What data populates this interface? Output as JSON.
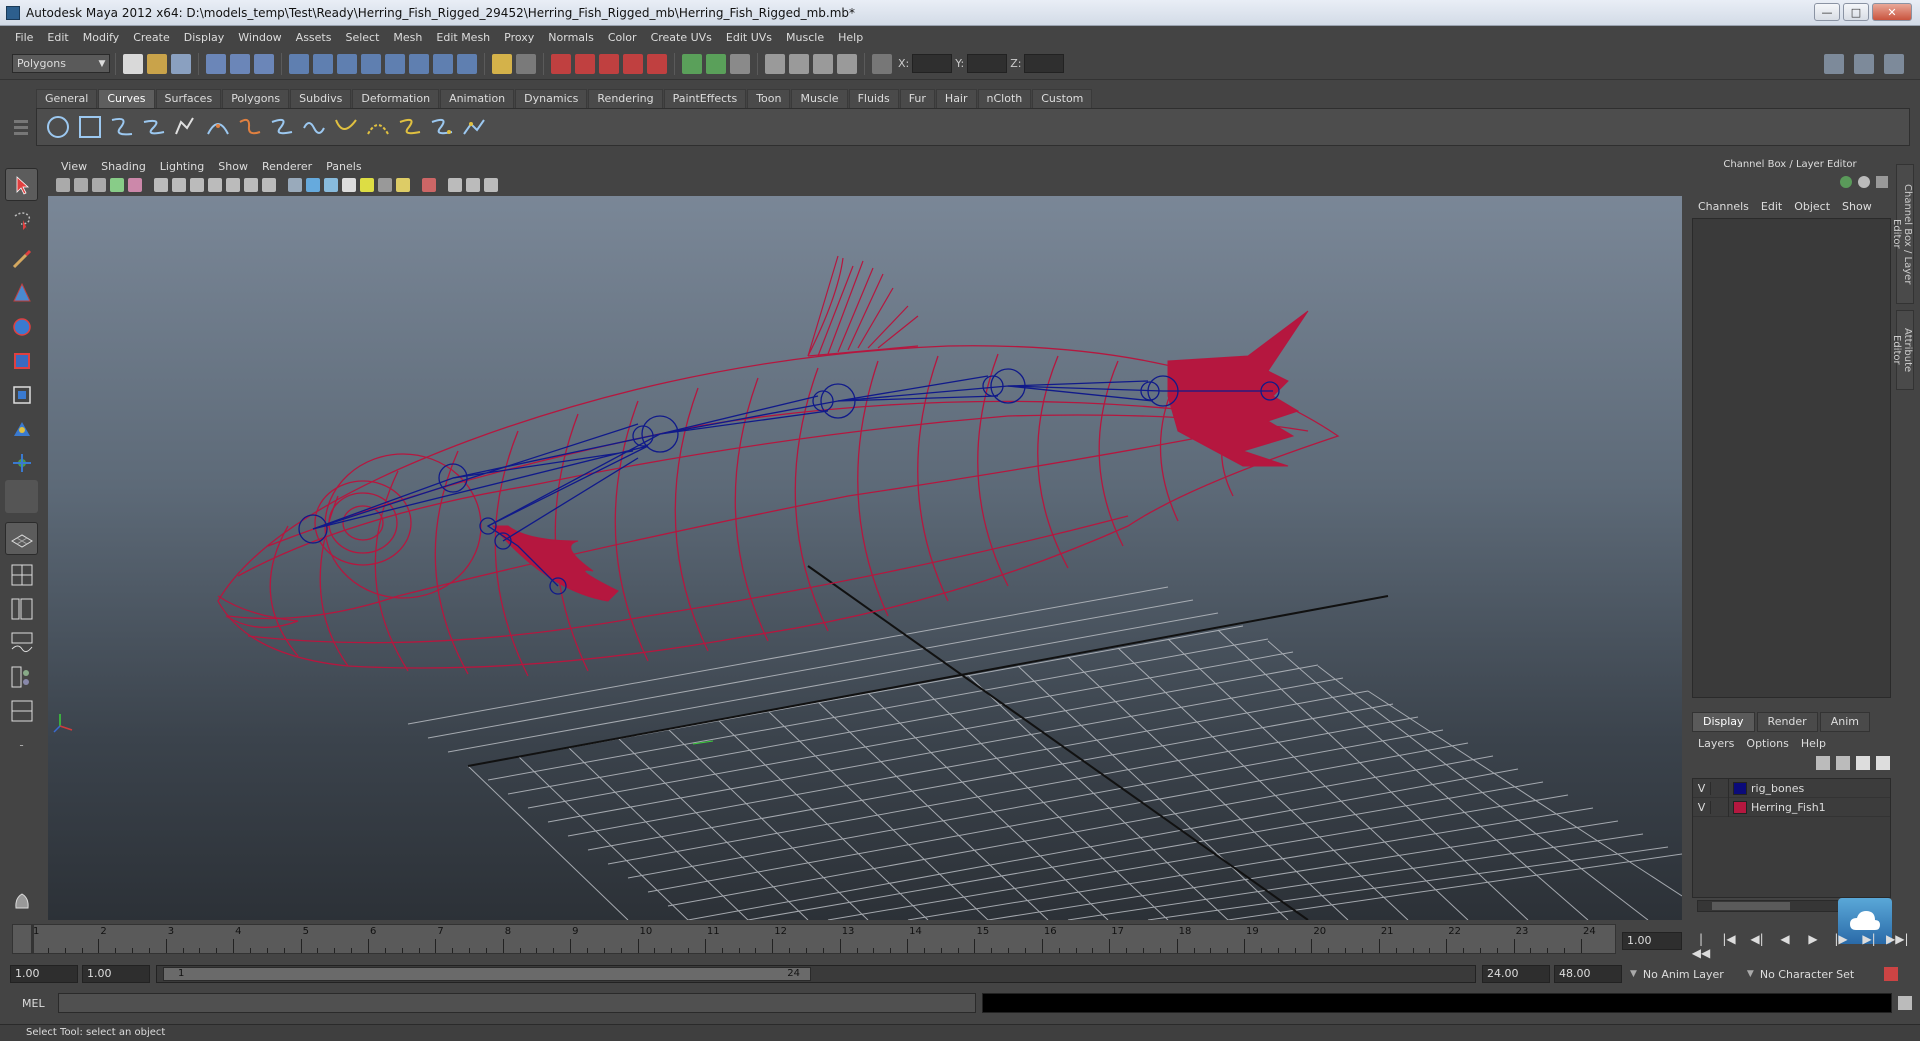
{
  "window": {
    "title": "Autodesk Maya 2012 x64: D:\\models_temp\\Test\\Ready\\Herring_Fish_Rigged_29452\\Herring_Fish_Rigged_mb\\Herring_Fish_Rigged_mb.mb*",
    "minimize": "—",
    "maximize": "□",
    "close": "✕"
  },
  "menubar": [
    "File",
    "Edit",
    "Modify",
    "Create",
    "Display",
    "Window",
    "Assets",
    "Select",
    "Mesh",
    "Edit Mesh",
    "Proxy",
    "Normals",
    "Color",
    "Create UVs",
    "Edit UVs",
    "Muscle",
    "Help"
  ],
  "statusline": {
    "mode": "Polygons",
    "x_label": "X:",
    "y_label": "Y:",
    "z_label": "Z:"
  },
  "shelf": {
    "tabs": [
      "General",
      "Curves",
      "Surfaces",
      "Polygons",
      "Subdivs",
      "Deformation",
      "Animation",
      "Dynamics",
      "Rendering",
      "PaintEffects",
      "Toon",
      "Muscle",
      "Fluids",
      "Fur",
      "Hair",
      "nCloth",
      "Custom"
    ],
    "active_tab": "Curves"
  },
  "panel": {
    "menus": [
      "View",
      "Shading",
      "Lighting",
      "Show",
      "Renderer",
      "Panels"
    ]
  },
  "channelbox": {
    "header": "Channel Box / Layer Editor",
    "menus": [
      "Channels",
      "Edit",
      "Object",
      "Show"
    ],
    "vertical_tabs": [
      "Channel Box / Layer Editor",
      "Attribute Editor"
    ]
  },
  "layers": {
    "tabs": [
      "Display",
      "Render",
      "Anim"
    ],
    "active_tab": "Display",
    "menus": [
      "Layers",
      "Options",
      "Help"
    ],
    "rows": [
      {
        "visible": "V",
        "name": "rig_bones",
        "color": "#0a0a7a"
      },
      {
        "visible": "V",
        "name": "Herring_Fish1",
        "color": "#b5173f"
      }
    ]
  },
  "timeline": {
    "ticks": [
      "1",
      "2",
      "3",
      "4",
      "5",
      "6",
      "7",
      "8",
      "9",
      "10",
      "11",
      "12",
      "13",
      "14",
      "15",
      "16",
      "17",
      "18",
      "19",
      "20",
      "21",
      "22",
      "23",
      "24"
    ],
    "current_frame": "1.00",
    "playback_buttons": [
      "|◀◀",
      "|◀",
      "◀|",
      "◀",
      "▶",
      "|▶",
      "▶|",
      "▶▶|"
    ]
  },
  "range": {
    "start_time": "1.00",
    "playback_start": "1.00",
    "range_start_label": "1",
    "range_end_label": "24",
    "playback_end": "24.00",
    "end_time": "48.00",
    "anim_layer": "No Anim Layer",
    "character_set": "No Character Set"
  },
  "command": {
    "label": "MEL"
  },
  "helpline": "Select Tool: select an object",
  "colors": {
    "mesh_wire": "#b5173f",
    "bones": "#101a8a",
    "grid": "#b8bcc2"
  }
}
